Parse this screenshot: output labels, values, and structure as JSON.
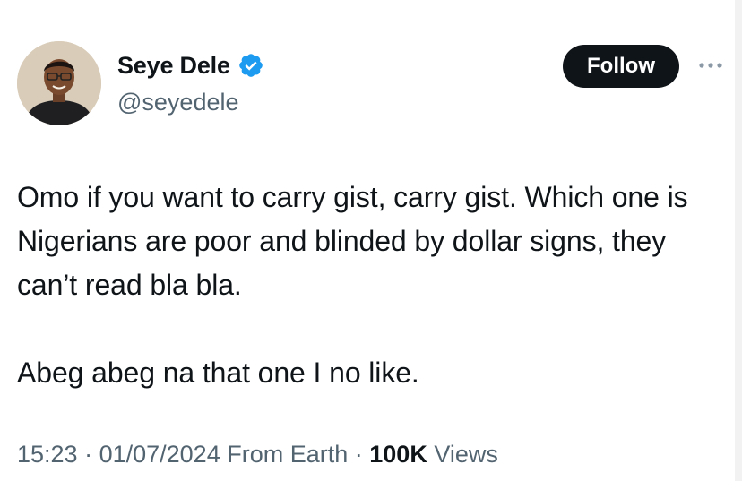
{
  "author": {
    "display_name": "Seye Dele",
    "handle": "@seyedele",
    "verified": true
  },
  "actions": {
    "follow_label": "Follow",
    "more_icon": "more-horizontal-icon"
  },
  "tweet": {
    "paragraphs": [
      "Omo if you want to carry gist, carry gist. Which one is Nigerians are poor and blinded by dollar signs, they can’t read bla bla.",
      "Abeg abeg na that one I no like."
    ]
  },
  "meta": {
    "time": "15:23",
    "separator": " · ",
    "date": "01/07/2024",
    "source": "From Earth",
    "views_count": "100K",
    "views_label": "Views"
  },
  "colors": {
    "text_primary": "#0f1419",
    "text_secondary": "#536471",
    "verified_blue": "#1d9bf0",
    "follow_bg": "#0f1419"
  }
}
